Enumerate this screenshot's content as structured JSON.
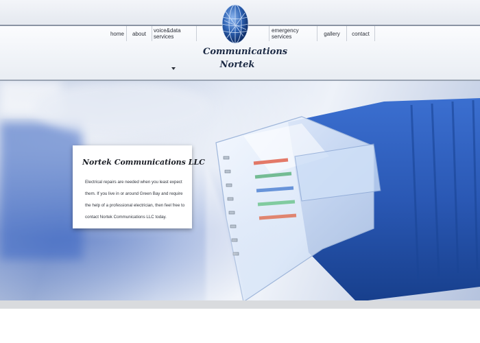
{
  "brand": {
    "name_line1": "Communications",
    "name_line2": "Nortek"
  },
  "nav": {
    "items": [
      {
        "label": "home"
      },
      {
        "label": "about"
      },
      {
        "label": "voice&data services"
      },
      {
        "label": "emergency services"
      },
      {
        "label": "gallery"
      },
      {
        "label": "contact"
      }
    ]
  },
  "hero": {
    "card": {
      "title": "Nortek Communications LLC",
      "body": "Electrical repairs are needed when you least expect them. If you live in or around Green Bay and require the help of a professional electrician, then feel free to contact Nortek Communications LLC today."
    }
  },
  "colors": {
    "cable_blue": "#2f5fbf",
    "nav_text": "#2b2f38",
    "logo_text": "#1c2a44"
  },
  "icons": {
    "logo": "globe-icon",
    "dropdown": "caret-down-icon"
  }
}
